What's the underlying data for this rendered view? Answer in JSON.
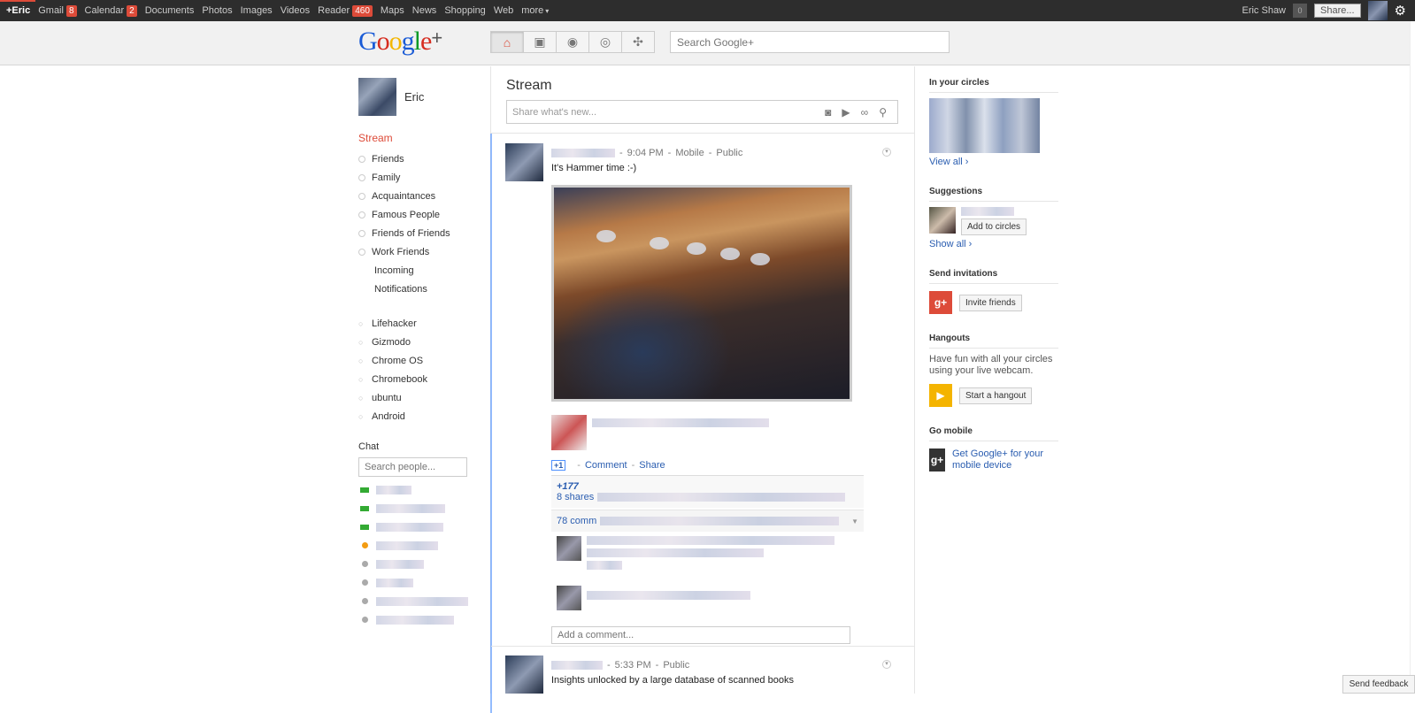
{
  "topbar": {
    "items": [
      {
        "label": "+Eric"
      },
      {
        "label": "Gmail",
        "badge": "8"
      },
      {
        "label": "Calendar",
        "badge": "2"
      },
      {
        "label": "Documents"
      },
      {
        "label": "Photos"
      },
      {
        "label": "Images"
      },
      {
        "label": "Videos"
      },
      {
        "label": "Reader",
        "badge": "460"
      },
      {
        "label": "Maps"
      },
      {
        "label": "News"
      },
      {
        "label": "Shopping"
      },
      {
        "label": "Web"
      },
      {
        "label": "more"
      }
    ],
    "user_name": "Eric Shaw",
    "notification_count": "0",
    "share_label": "Share...",
    "settings_icon": "gear-icon"
  },
  "header": {
    "logo_text": "Google+",
    "nav_icons": [
      "home-icon",
      "photos-icon",
      "profile-icon",
      "circles-icon",
      "games-icon"
    ],
    "search_placeholder": "Search Google+"
  },
  "left": {
    "profile_name": "Eric",
    "stream_label": "Stream",
    "circles": [
      "Friends",
      "Family",
      "Acquaintances",
      "Famous People",
      "Friends of Friends",
      "Work Friends"
    ],
    "sub_items": [
      "Incoming",
      "Notifications"
    ],
    "sparks": [
      "Lifehacker",
      "Gizmodo",
      "Chrome OS",
      "Chromebook",
      "ubuntu",
      "Android"
    ],
    "chat_title": "Chat",
    "chat_placeholder": "Search people...",
    "chat_statuses": [
      "video",
      "video",
      "video",
      "away",
      "idle",
      "idle",
      "idle",
      "idle"
    ]
  },
  "stream": {
    "title": "Stream",
    "share_placeholder": "Share what's new...",
    "share_icons": [
      "camera-icon",
      "video-icon",
      "link-icon",
      "location-icon"
    ],
    "post1": {
      "time": "9:04 PM",
      "source": "Mobile",
      "visibility": "Public",
      "text": "It's Hammer time :-)",
      "plus_one": "+1",
      "comment_label": "Comment",
      "share_label": "Share",
      "plus_count": "+177",
      "shares": "8 shares",
      "comments_label": "78 comm",
      "add_comment_placeholder": "Add a comment..."
    },
    "post2": {
      "time": "5:33 PM",
      "visibility": "Public",
      "text": "Insights unlocked by a large database of scanned books"
    }
  },
  "right": {
    "in_circles_title": "In your circles",
    "view_all": "View all ›",
    "suggestions_title": "Suggestions",
    "add_to_circles": "Add to circles",
    "show_all": "Show all ›",
    "invitations_title": "Send invitations",
    "invite_button": "Invite friends",
    "hangouts_title": "Hangouts",
    "hangouts_desc": "Have fun with all your circles using your live webcam.",
    "hangout_button": "Start a hangout",
    "mobile_title": "Go mobile",
    "mobile_link": "Get Google+ for your mobile device"
  },
  "feedback": "Send feedback"
}
